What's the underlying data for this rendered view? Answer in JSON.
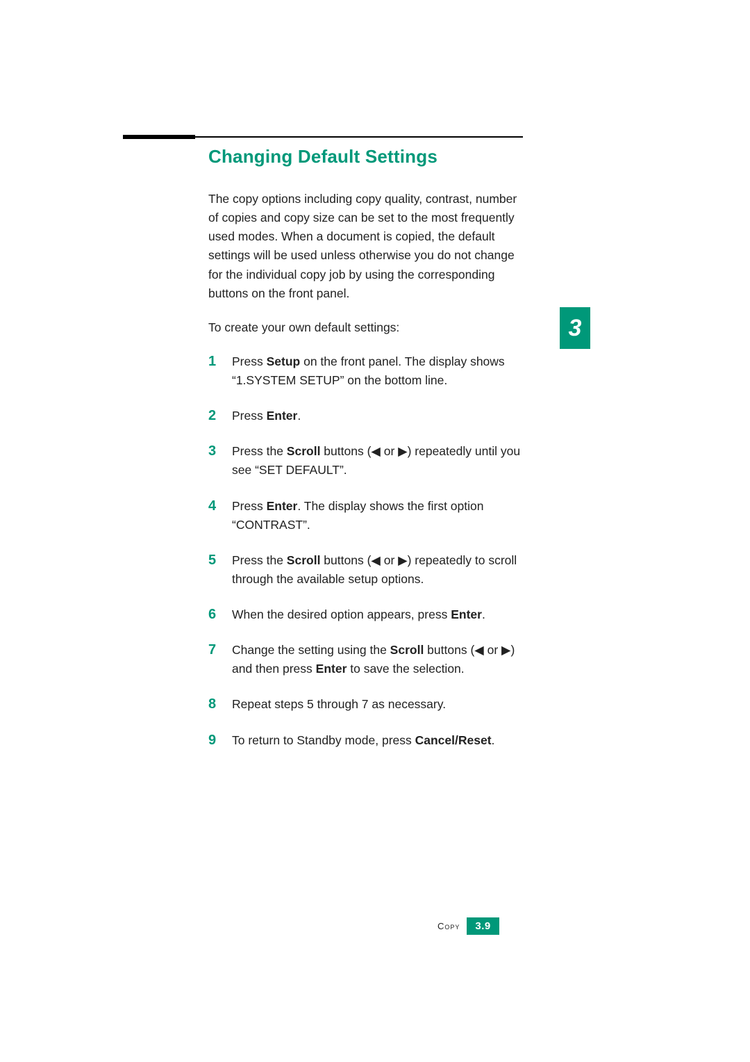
{
  "title": "Changing Default Settings",
  "intro": "The copy options including copy quality, contrast, number of copies and copy size can be set to the most frequently used modes. When a document is copied, the default settings will be used unless otherwise you do not change for the individual copy job by using the corresponding buttons on the front panel.",
  "lead": "To create your own default settings:",
  "steps": {
    "s1a": "Press ",
    "s1b": "Setup",
    "s1c": " on the front panel. The display shows “1.SYSTEM SETUP” on the bottom line.",
    "s2a": "Press ",
    "s2b": "Enter",
    "s2c": ".",
    "s3a": "Press the ",
    "s3b": "Scroll",
    "s3c": " buttons (◀ or ▶) repeatedly until you see “SET DEFAULT”.",
    "s4a": "Press ",
    "s4b": "Enter",
    "s4c": ". The display shows the first option “CONTRAST”.",
    "s5a": "Press the ",
    "s5b": "Scroll",
    "s5c": " buttons (◀ or ▶) repeatedly to scroll through the available setup options.",
    "s6a": "When the desired option appears, press ",
    "s6b": "Enter",
    "s6c": ".",
    "s7a": "Change the setting using the ",
    "s7b": "Scroll",
    "s7c": " buttons (◀ or ▶) and then press ",
    "s7d": "Enter",
    "s7e": " to save the selection.",
    "s8": "Repeat steps 5 through 7 as necessary.",
    "s9a": "To return to Standby mode, press ",
    "s9b": "Cancel/Reset",
    "s9c": "."
  },
  "tab": "3",
  "footer": {
    "section": "Copy",
    "page": "3.9"
  }
}
